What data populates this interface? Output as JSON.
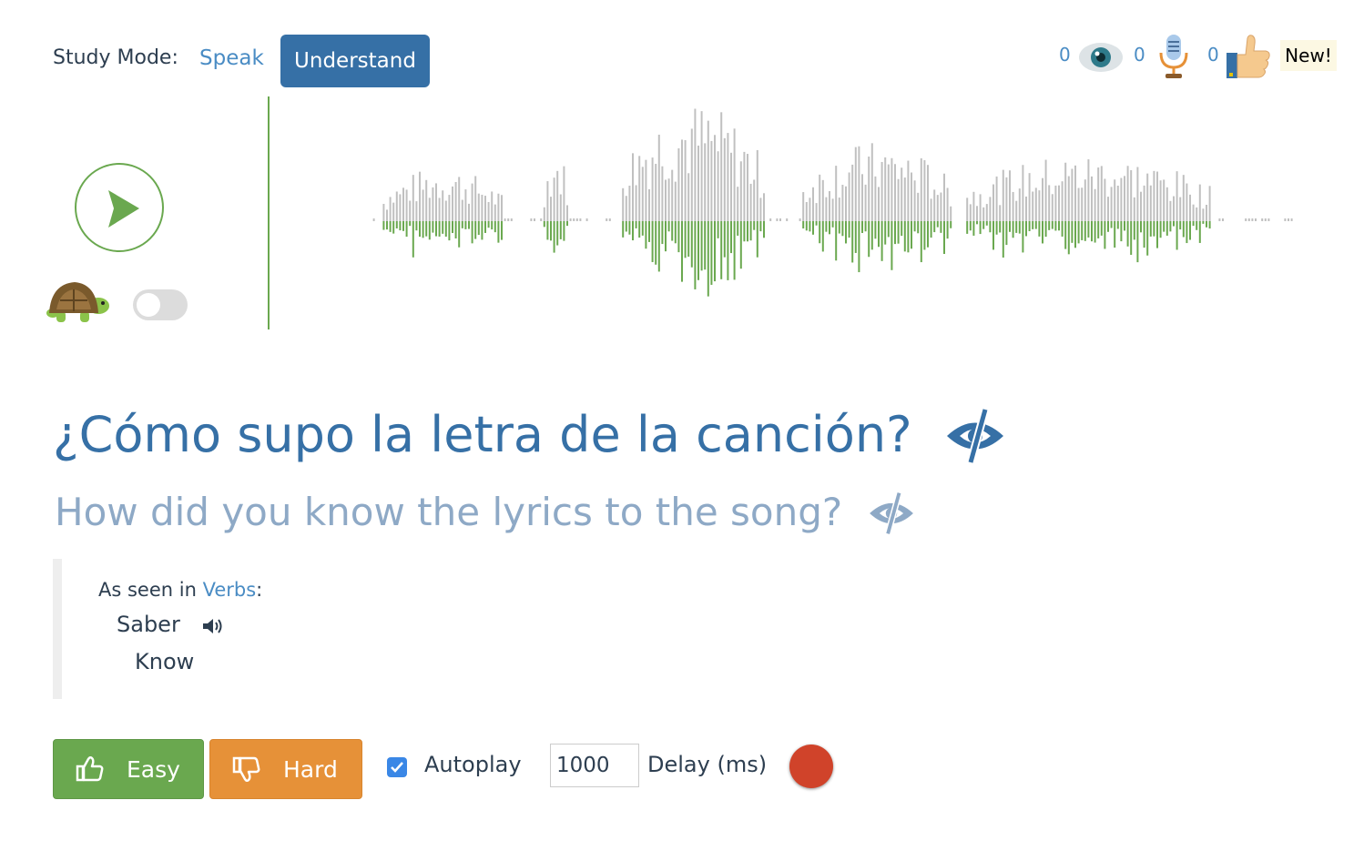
{
  "study_mode": {
    "label": "Study Mode:",
    "speak_label": "Speak",
    "understand_label": "Understand",
    "active": "Understand"
  },
  "stats": {
    "seen_count": "0",
    "spoken_count": "0",
    "liked_count": "0",
    "new_badge": "New!",
    "icons": [
      "eye-icon",
      "microphone-icon",
      "thumbs-up-icon"
    ]
  },
  "player": {
    "play_icon": "play-icon",
    "slow_icon": "turtle-icon",
    "slow_mode_on": false
  },
  "sentence": {
    "spanish": "¿Cómo supo la letra de la canción?",
    "english": "How did you know the lyrics to the song?"
  },
  "reference": {
    "prefix": "As seen in ",
    "link": "Verbs",
    "suffix": ":",
    "word": "Saber",
    "translation": "Know"
  },
  "controls": {
    "easy_label": "Easy",
    "hard_label": "Hard",
    "autoplay_label": "Autoplay",
    "autoplay_checked": true,
    "delay_value": "1000",
    "delay_label": "Delay (ms)"
  },
  "colors": {
    "primary": "#3670a6",
    "link": "#4a8cc4",
    "green": "#6aa84f",
    "orange": "#e69138",
    "record": "#d0432a",
    "waveform_top": "#c0c0c0",
    "waveform_bottom": "#6aa84f"
  }
}
